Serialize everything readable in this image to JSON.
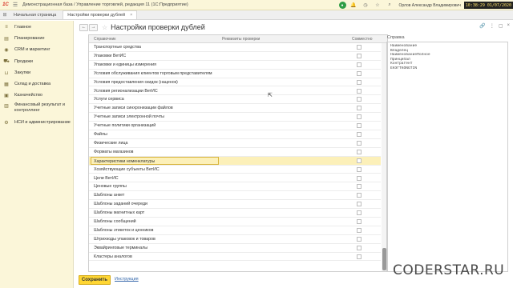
{
  "titlebar": {
    "logo": "1С",
    "title": "Демонстрационная база / Управление торговлей, редакция 11  (1С:Предприятие)",
    "user": "Орлов Александр Владимирович",
    "clock": "10:38:29  01/07/2020"
  },
  "tabs": [
    {
      "label": "Начальная страница"
    },
    {
      "label": "Настройки проверки дублей",
      "active": true
    }
  ],
  "sidebar": {
    "items": [
      {
        "label": "Главное",
        "icon": "menu-icon"
      },
      {
        "label": "Планирование",
        "icon": "chart-icon"
      },
      {
        "label": "CRM и маркетинг",
        "icon": "crm-icon"
      },
      {
        "label": "Продажи",
        "icon": "cart-icon"
      },
      {
        "label": "Закупки",
        "icon": "basket-icon"
      },
      {
        "label": "Склад и доставка",
        "icon": "warehouse-icon"
      },
      {
        "label": "Казначейство",
        "icon": "money-icon"
      },
      {
        "label": "Финансовый результат и",
        "label2": "контроллинг",
        "icon": "finance-icon"
      },
      {
        "label": "НСИ и администрирование",
        "icon": "gear-icon"
      }
    ]
  },
  "page": {
    "title": "Настройки проверки дублей"
  },
  "table": {
    "columns": [
      "Справочник",
      "Реквизиты проверки",
      "Совместно"
    ],
    "rows": [
      "Транспортные средства",
      "Упаковки ВетИС",
      "Упаковки и единицы измерения",
      "Условия обслуживания клиентов торговым представителям",
      "Условия предоставления скидок (наценок)",
      "Условия регионализации ВетИС",
      "Услуги сервиса",
      "Учетные записи синхронизации файлов",
      "Учетные записи электронной почты",
      "Учетные политики организаций",
      "Файлы",
      "Физические лица",
      "Форматы магазинов",
      "Характеристики номенклатуры",
      "Хозяйствующие субъекты ВетИС",
      "Цели ВетИС",
      "Ценовые группы",
      "Шаблоны анкет",
      "Шаблоны заданий очереди",
      "Шаблоны магнитных карт",
      "Шаблоны сообщений",
      "Шаблоны этикеток и ценников",
      "Штрихкоды упаковок и товаров",
      "Эквайринговые терминалы",
      "Кластеры аналогов"
    ],
    "selected_index": 13
  },
  "help": {
    "label": "Справка",
    "lines": [
      "Наименование",
      "Владелец",
      "НаименованиеПолное",
      "Принципал",
      "Контрагент",
      "ЕНЭГТКОNGTIN"
    ]
  },
  "footer": {
    "save": "Сохранить",
    "instruction": "Инструкция"
  },
  "watermark": "CODERSTAR.RU"
}
